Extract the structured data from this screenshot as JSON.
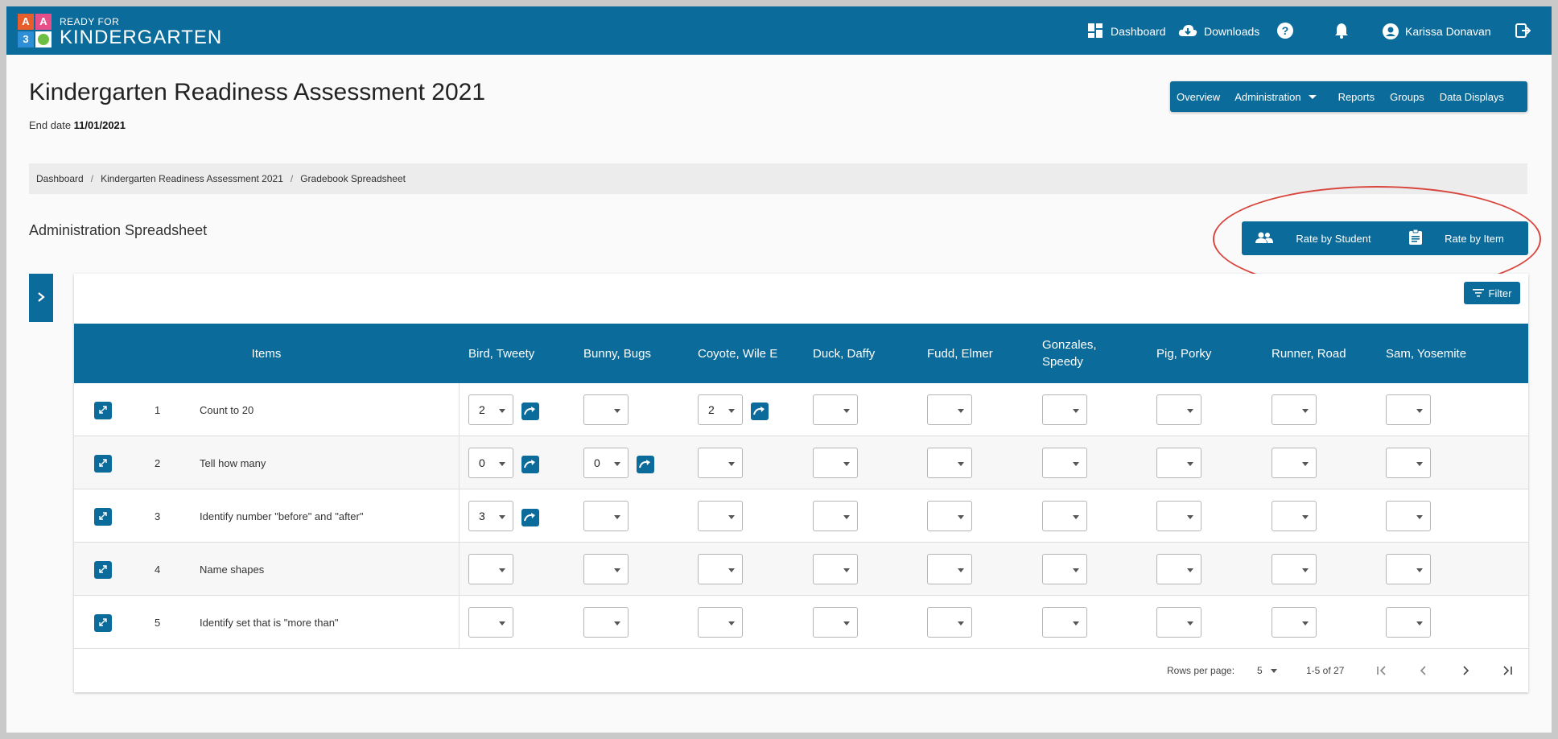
{
  "header": {
    "logo_letters": [
      "A",
      "A",
      "3",
      ""
    ],
    "logo_colors": [
      "#e85d2c",
      "#e84f8a",
      "#2f8fd6",
      "#6cbf43"
    ],
    "logo_small": "READY FOR",
    "logo_big": "KINDERGARTEN",
    "nav": {
      "dashboard": "Dashboard",
      "downloads": "Downloads",
      "user": "Karissa Donavan"
    }
  },
  "page": {
    "title": "Kindergarten Readiness Assessment 2021",
    "end_date_label": "End date",
    "end_date_value": "11/01/2021"
  },
  "menu": {
    "overview": "Overview",
    "administration": "Administration",
    "reports": "Reports",
    "groups": "Groups",
    "data_displays": "Data Displays"
  },
  "breadcrumb": [
    "Dashboard",
    "Kindergarten Readiness Assessment 2021",
    "Gradebook Spreadsheet"
  ],
  "sheet": {
    "title": "Administration Spreadsheet",
    "rate_by_student": "Rate by Student",
    "rate_by_item": "Rate by Item",
    "filter": "Filter"
  },
  "table": {
    "items_header": "Items",
    "students": [
      "Bird, Tweety",
      "Bunny, Bugs",
      "Coyote, Wile E",
      "Duck, Daffy",
      "Fudd, Elmer",
      "Gonzales, Speedy",
      "Pig, Porky",
      "Runner, Road",
      "Sam, Yosemite"
    ],
    "rows": [
      {
        "num": "1",
        "label": "Count to 20",
        "values": [
          "2",
          "",
          "2",
          "",
          "",
          "",
          "",
          "",
          ""
        ]
      },
      {
        "num": "2",
        "label": "Tell how many",
        "values": [
          "0",
          "0",
          "",
          "",
          "",
          "",
          "",
          "",
          ""
        ]
      },
      {
        "num": "3",
        "label": "Identify number \"before\" and \"after\"",
        "values": [
          "3",
          "",
          "",
          "",
          "",
          "",
          "",
          "",
          ""
        ]
      },
      {
        "num": "4",
        "label": "Name shapes",
        "values": [
          "",
          "",
          "",
          "",
          "",
          "",
          "",
          "",
          ""
        ]
      },
      {
        "num": "5",
        "label": "Identify set that is \"more than\"",
        "values": [
          "",
          "",
          "",
          "",
          "",
          "",
          "",
          "",
          ""
        ]
      }
    ]
  },
  "footer": {
    "rows_per_page_label": "Rows per page:",
    "rows_per_page_value": "5",
    "range": "1-5 of 27"
  },
  "colors": {
    "primary": "#0b6b9b",
    "highlight_oval": "#d9463e"
  }
}
